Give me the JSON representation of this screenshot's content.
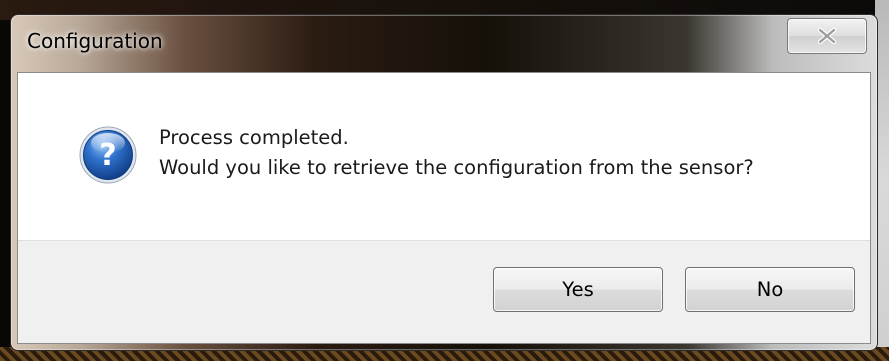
{
  "window": {
    "title": "Configuration",
    "close_icon": "close-icon"
  },
  "message": {
    "icon": "question-icon",
    "line1": "Process completed.",
    "line2": "Would you like to retrieve the configuration from the sensor?"
  },
  "buttons": {
    "yes_label": "Yes",
    "no_label": "No"
  },
  "colors": {
    "icon_blue": "#1f5fb8",
    "dialog_background": "#ffffff",
    "footer_background": "#f0f0f0"
  }
}
